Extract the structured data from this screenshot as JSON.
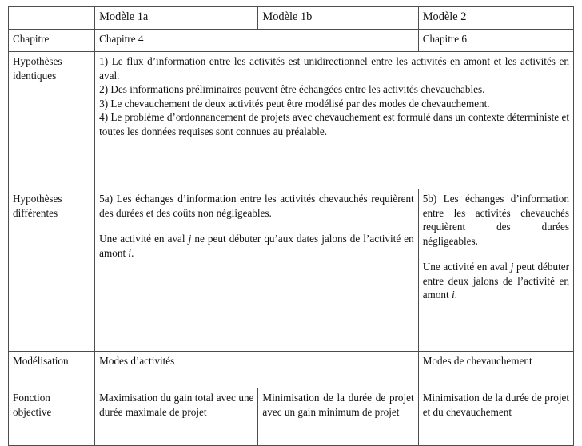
{
  "document": {
    "type": "comparison-table",
    "language": "fr",
    "border_color": "#4d4d4d",
    "background_color": "#ffffff",
    "text_color": "#111111"
  },
  "table": {
    "columns": [
      {
        "id": "label",
        "header": ""
      },
      {
        "id": "modele_1a",
        "header": "Modèle 1a"
      },
      {
        "id": "modele_1b",
        "header": "Modèle 1b"
      },
      {
        "id": "modele_2",
        "header": "Modèle 2"
      }
    ],
    "rows": {
      "chapitre": {
        "label": "Chapitre",
        "cells": {
          "modeles_1a_1b": "Chapitre 4",
          "modele_2": "Chapitre 6"
        }
      },
      "hypotheses_identiques": {
        "label_line1": "Hypothèses",
        "label_line2": "identiques",
        "paragraphs": [
          "1) Le flux d’information entre les activités est unidirectionnel entre les activités en amont et les activités en aval.",
          "2) Des informations préliminaires peuvent être échangées entre les activités chevauchables.",
          "3) Le chevauchement de deux activités peut être modélisé par des modes de chevauchement.",
          "4) Le problème d’ordonnancement de projets avec chevauchement est formulé dans un contexte déterministe et toutes les données requises sont connues au préalable."
        ]
      },
      "hypotheses_differentes": {
        "label_line1": "Hypothèses",
        "label_line2": "différentes",
        "modeles_1a_1b": {
          "paragraph_1": "5a) Les échanges d’information entre les activités chevauchés requièrent des durées et des coûts non négligeables.",
          "paragraph_2_pre": "Une activité en aval ",
          "paragraph_2_var1": "j",
          "paragraph_2_mid": " ne peut débuter qu’aux dates jalons de l’activité en amont ",
          "paragraph_2_var2": "i",
          "paragraph_2_post": "."
        },
        "modele_2": {
          "paragraph_1": "5b) Les échanges d’information entre les activités chevauchés requièrent des durées négligeables.",
          "paragraph_2_pre": "Une activité en aval ",
          "paragraph_2_var1": "j",
          "paragraph_2_mid": " peut débuter entre deux jalons de l’activité en amont ",
          "paragraph_2_var2": "i",
          "paragraph_2_post": "."
        }
      },
      "modelisation": {
        "label": "Modélisation",
        "cells": {
          "modeles_1a_1b": "Modes d’activités",
          "modele_2": "Modes de chevauchement"
        }
      },
      "fonction_objective": {
        "label_line1": "Fonction",
        "label_line2": "objective",
        "cells": {
          "modele_1a": "Maximisation du gain total avec une durée maximale de projet",
          "modele_1b": "Minimisation de la durée de projet avec un gain minimum de projet",
          "modele_2": "Minimisation de la durée de projet et du chevauchement"
        }
      }
    }
  }
}
